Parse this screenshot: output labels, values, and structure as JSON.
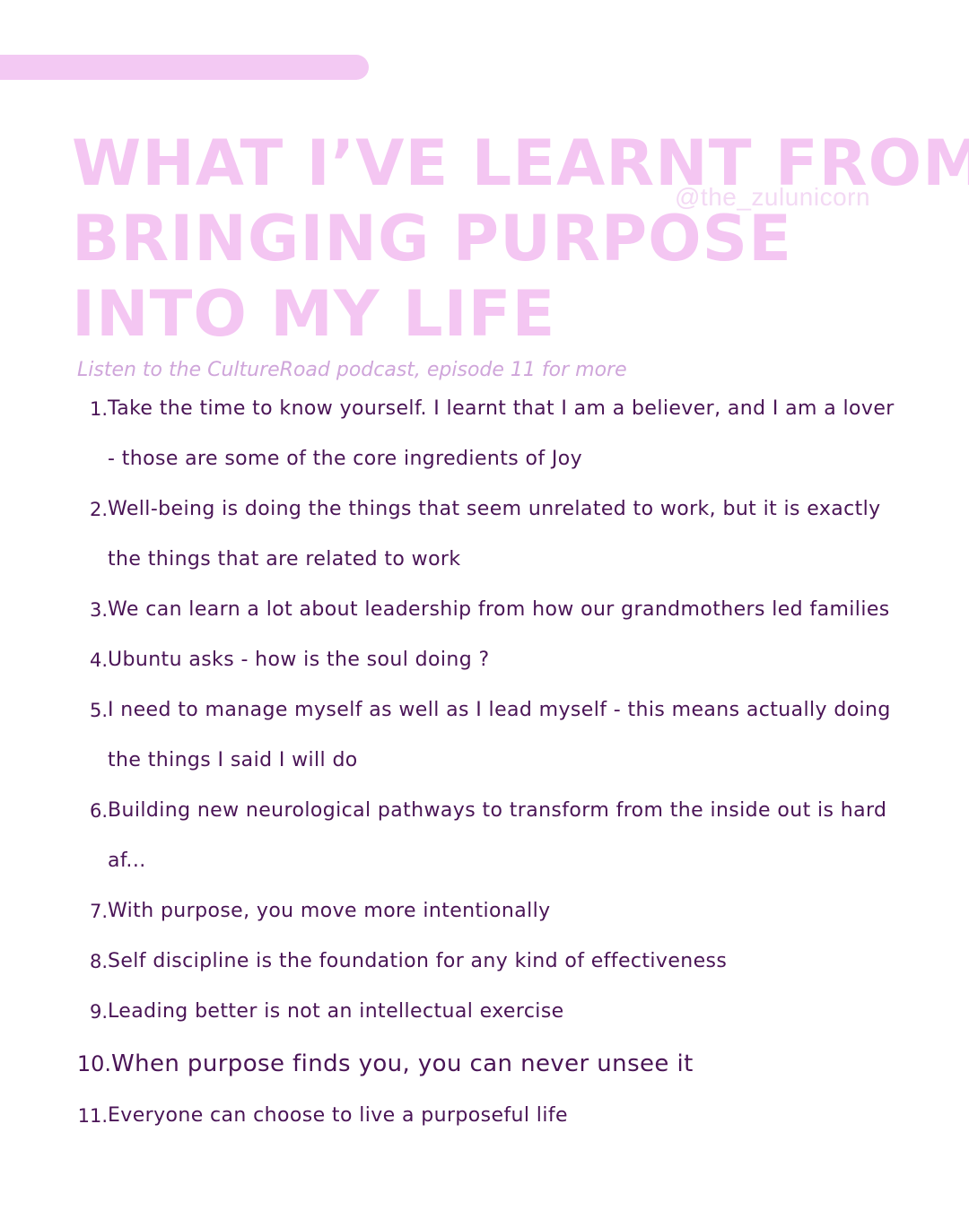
{
  "header": {
    "title_lines": [
      "WHAT I’VE LEARNT FROM",
      "BRINGING PURPOSE",
      "INTO MY LIFE"
    ],
    "handle": "@the_zulunicorn",
    "subtitle": "Listen to the CultureRoad podcast, episode 11 for more"
  },
  "list": {
    "items": [
      {
        "num": "1.",
        "text": "Take the time to know yourself. I learnt that I am a believer, and I am a lover - those are some of the core ingredients of Joy"
      },
      {
        "num": "2.",
        "text": "Well-being is doing the things that seem unrelated to work, but it is exactly the things that are related to work"
      },
      {
        "num": "3.",
        "text": "We can learn a lot about leadership from how our grandmothers led families"
      },
      {
        "num": "4.",
        "text": "Ubuntu asks - how is the soul doing ?"
      },
      {
        "num": "5.",
        "text": "I need to manage myself as well as I lead myself - this means actually doing the things I said I will do"
      },
      {
        "num": "6.",
        "text": "Building new neurological pathways to transform from the inside  out is hard af..."
      },
      {
        "num": "7.",
        "text": "With purpose, you move more intentionally"
      },
      {
        "num": "8.",
        "text": "Self discipline is the foundation for any kind of effectiveness"
      },
      {
        "num": "9.",
        "text": "Leading better is not an intellectual exercise"
      },
      {
        "num": "10.",
        "text": "When purpose finds you, you can never unsee it"
      },
      {
        "num": "11.",
        "text": "Everyone can choose to live a purposeful life"
      }
    ]
  },
  "colors": {
    "title": "#f4c6f2",
    "accent_bar": "#f3c9f3",
    "body_text": "#4a1456",
    "subtitle": "#cfa5da"
  }
}
